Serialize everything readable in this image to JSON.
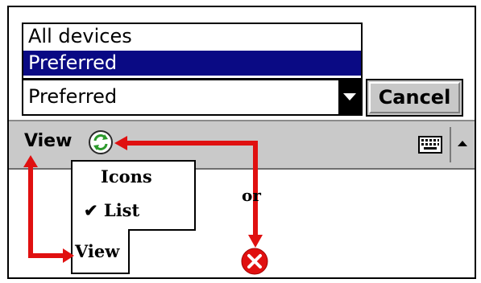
{
  "list": {
    "items": [
      {
        "label": "All devices",
        "selected": false
      },
      {
        "label": "Preferred",
        "selected": true
      },
      {
        "label": "Preferred",
        "selected": false
      }
    ]
  },
  "toolbar": {
    "cancel_label": "Cancel"
  },
  "menubar": {
    "view_label": "View",
    "refresh_icon": "refresh-icon",
    "keyboard_icon": "keyboard-icon",
    "sip_arrow_icon": "chevron-up-icon"
  },
  "popup_menu": {
    "items": [
      "Icons",
      "List"
    ],
    "checked_item": "List",
    "check_mark": "✔",
    "tab_label": "View"
  },
  "annotation": {
    "or_label": "or",
    "close_icon": "close-icon",
    "arrow_color": "#e01010"
  },
  "colors": {
    "selection": "#0a0a84",
    "menubar": "#c9c9c9"
  }
}
